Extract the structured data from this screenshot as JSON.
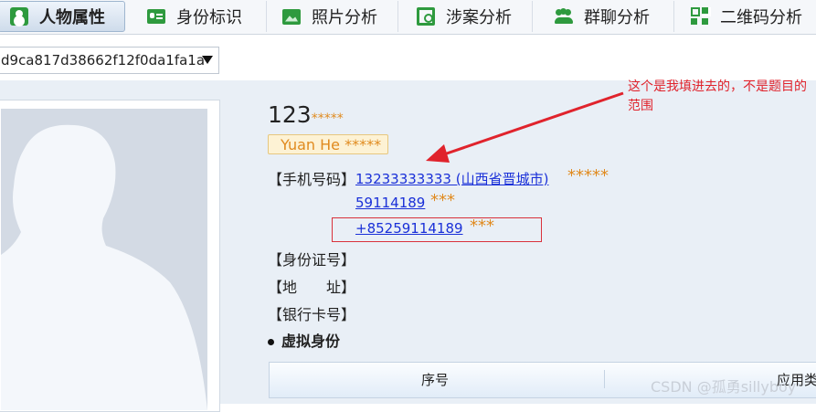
{
  "tabs": [
    {
      "label": "人物属性",
      "icon": "person-icon",
      "active": true
    },
    {
      "label": "身份标识",
      "icon": "id-card-icon"
    },
    {
      "label": "照片分析",
      "icon": "photo-icon"
    },
    {
      "label": "涉案分析",
      "icon": "case-search-icon"
    },
    {
      "label": "群聊分析",
      "icon": "group-icon"
    },
    {
      "label": "二维码分析",
      "icon": "qr-code-icon"
    }
  ],
  "id_select": {
    "value": "d9ca817d38662f12f0da1fa1a"
  },
  "profile": {
    "name": "123",
    "name_mask": "*****",
    "alias": "Yuan He *****",
    "phone_label": "【手机号码】",
    "phones": [
      {
        "number": "13233333333 (山西省晋城市)",
        "mask": "*****"
      },
      {
        "number": "59114189",
        "mask": "***"
      },
      {
        "number": "+85259114189",
        "mask": "***"
      }
    ],
    "id_label": "【身份证号】",
    "address_label": "【地　　址】",
    "bank_label": "【银行卡号】"
  },
  "annotation": "这个是我填进去的，不是题目的范围",
  "virtual_identity": {
    "title": "虚拟身份",
    "columns": [
      "序号",
      "应用类"
    ]
  },
  "watermark": "CSDN @孤勇sillyboy",
  "colors": {
    "accent_green": "#2e9a3e",
    "link": "#1a30d8",
    "mask": "#e08a1e",
    "annotation": "#e0232c"
  }
}
